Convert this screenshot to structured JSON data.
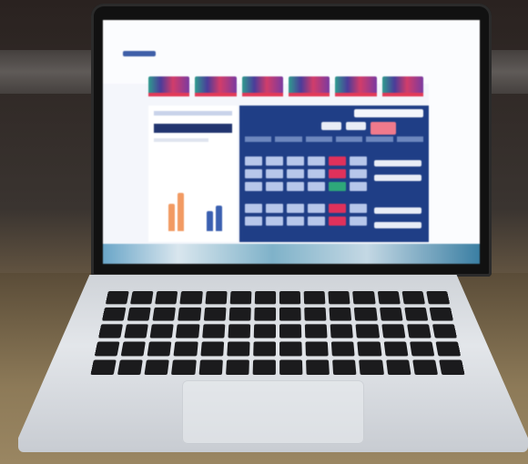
{
  "scene": "",
  "dashboard": {
    "tab_count": 6,
    "colors": {
      "header_blue": "#1f3e86",
      "accent_red": "#e0315b",
      "accent_green": "#2ea87a",
      "tile_teal": "#2f9c8e",
      "tile_magenta": "#d23d6a"
    }
  }
}
